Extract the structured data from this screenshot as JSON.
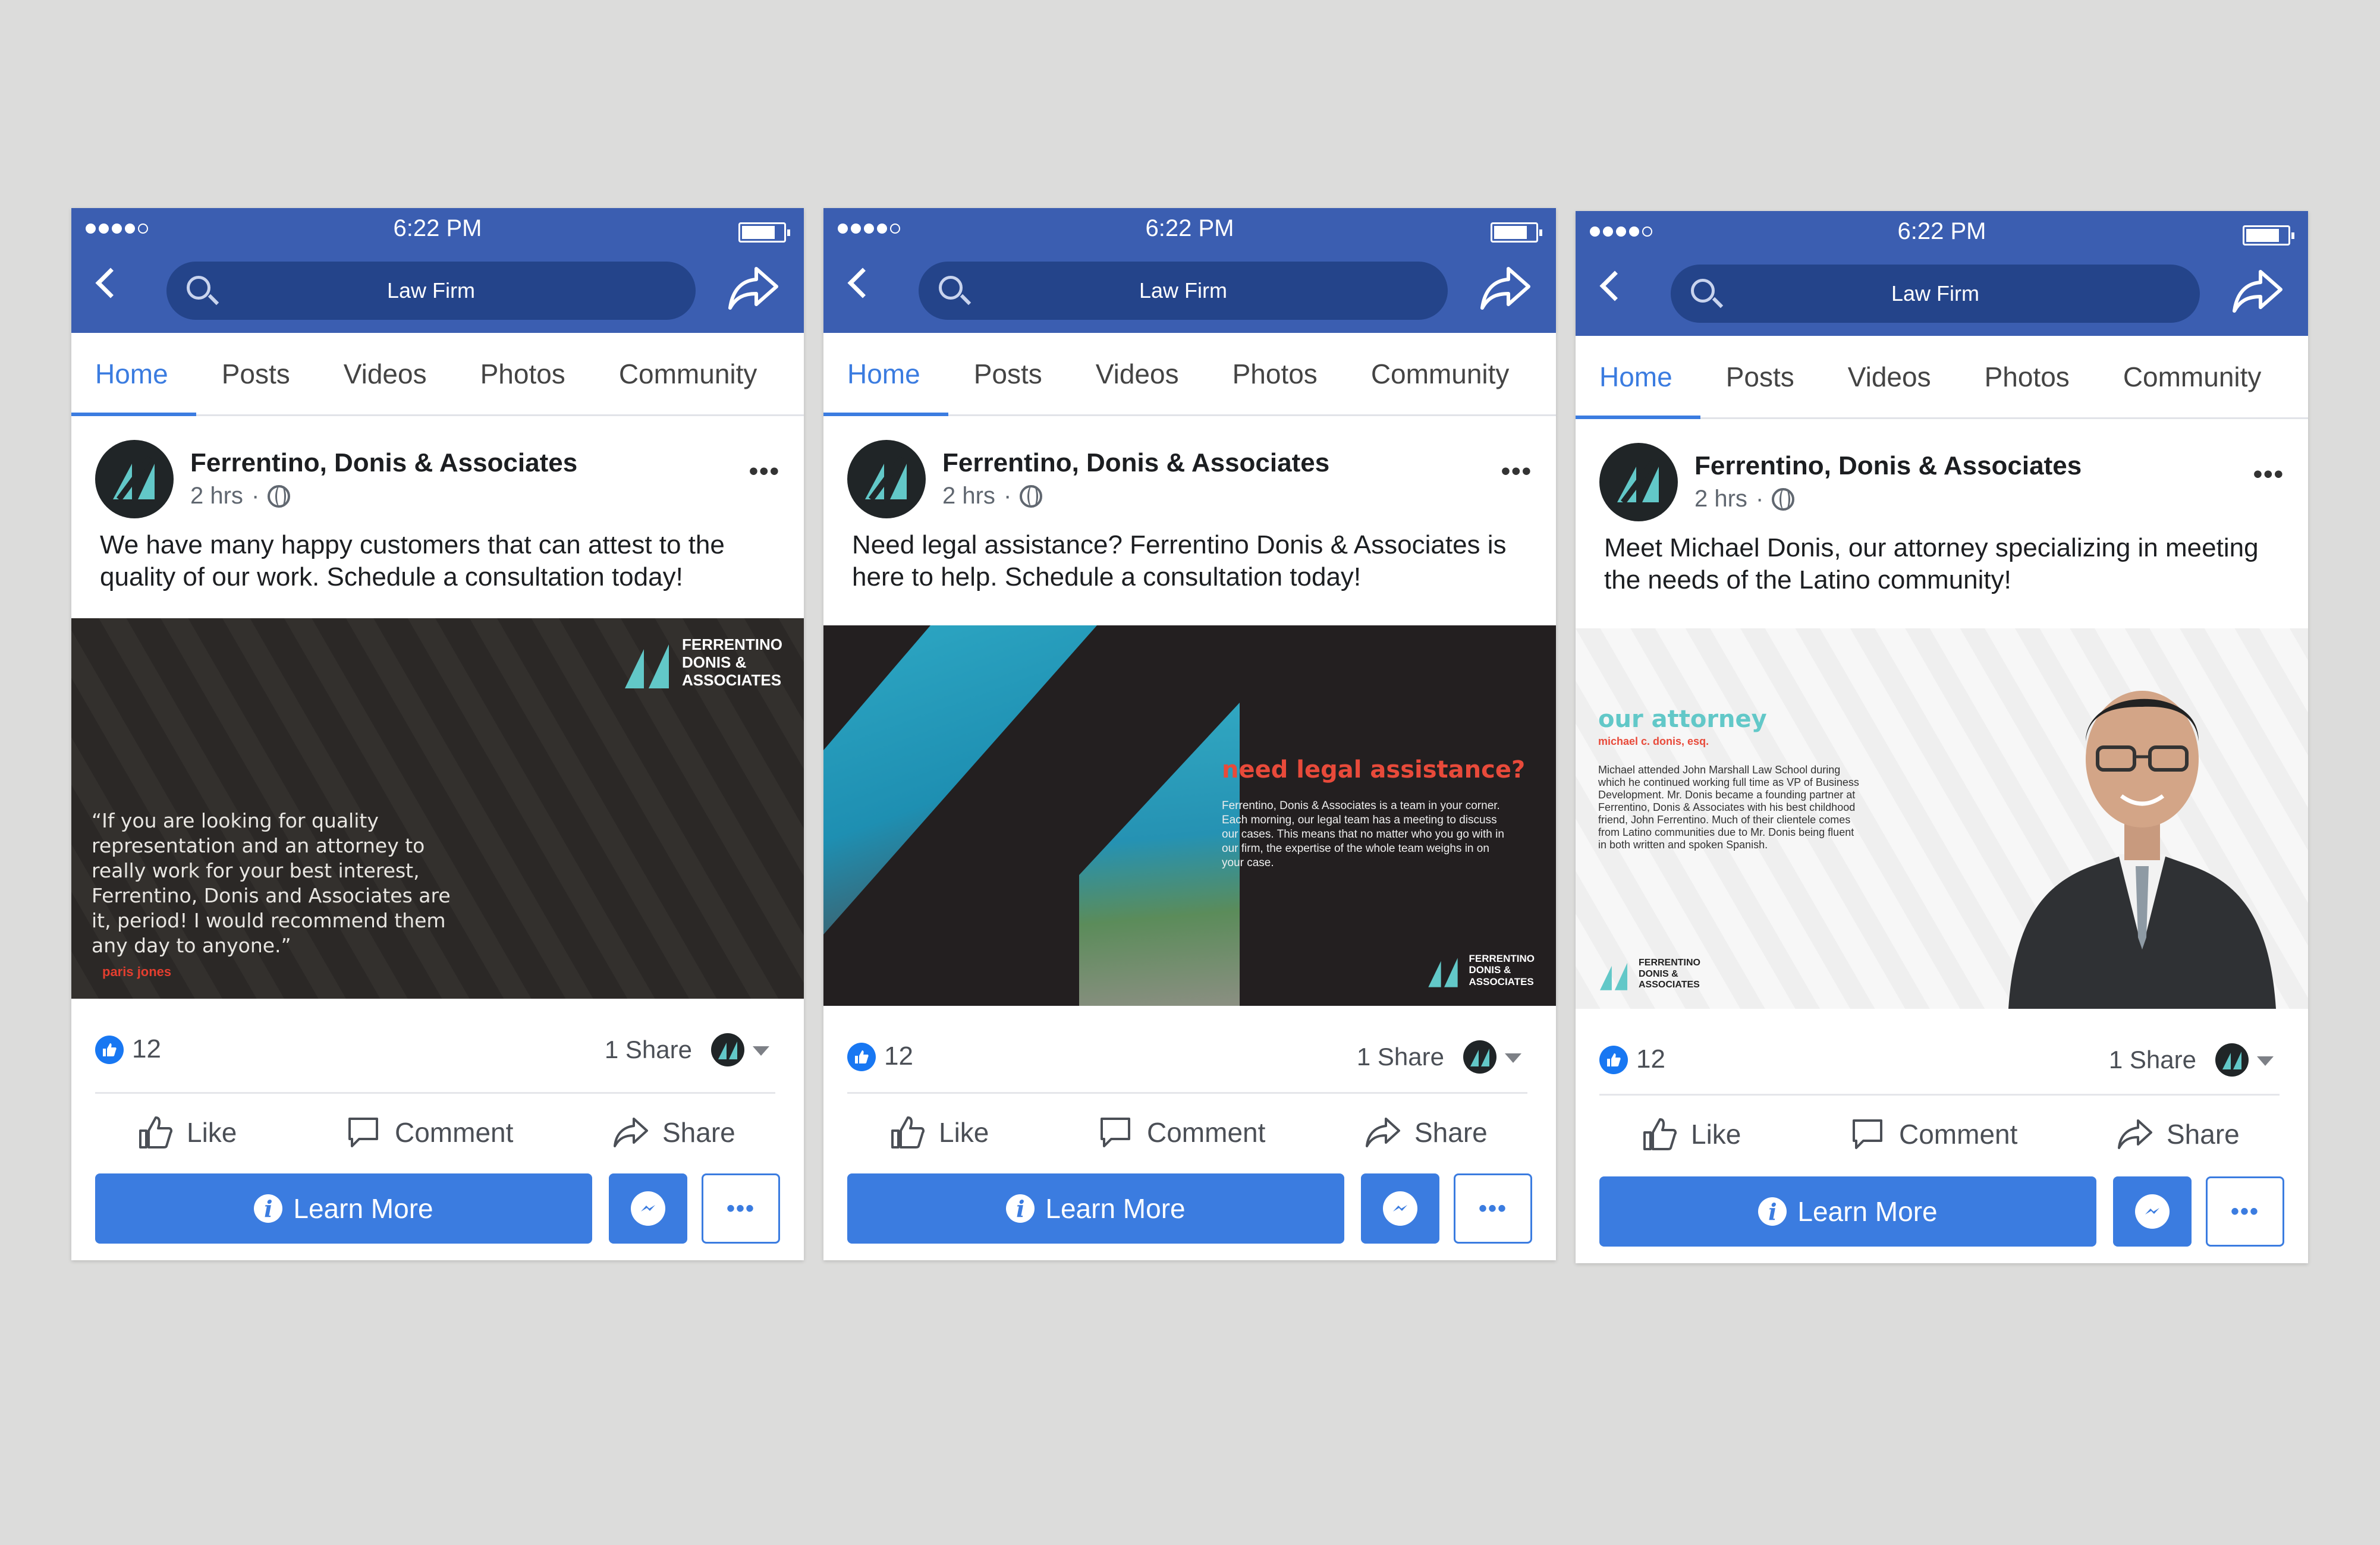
{
  "colors": {
    "background": "#dcdcdb",
    "header": "#3b5eb1",
    "search": "#24448a",
    "accent": "#3b7ce0",
    "brand_teal": "#62c8c8",
    "brand_red": "#e84a3a"
  },
  "status": {
    "time": "6:22 PM"
  },
  "header": {
    "search_text": "Law Firm"
  },
  "tabs": [
    "Home",
    "Posts",
    "Videos",
    "Photos",
    "Community"
  ],
  "brand": {
    "line1": "FERRENTINO",
    "line2": "DONIS &",
    "line3": "ASSOCIATES"
  },
  "posts": [
    {
      "page_name": "Ferrentino, Donis & Associates",
      "time": "2 hrs",
      "caption": "We have many happy customers that can attest to the quality of our work. Schedule a consultation today!",
      "image": {
        "quote": "“If you are looking for quality representation and an attorney to really work for your best interest, Ferrentino, Donis and Associates are it, period! I would recommend them any day to anyone.”",
        "author": "paris jones"
      },
      "likes": "12",
      "shares": "1 Share",
      "actions": {
        "like": "Like",
        "comment": "Comment",
        "share": "Share"
      },
      "cta": "Learn More"
    },
    {
      "page_name": "Ferrentino, Donis & Associates",
      "time": "2 hrs",
      "caption": "Need legal assistance? Ferrentino Donis & Associates is here to help. Schedule a consultation today!",
      "image": {
        "title": "need legal assistance?",
        "body": "Ferrentino, Donis & Associates is a team in your corner. Each morning, our legal team has a meeting to discuss our cases. This means that no matter who you go with in our firm, the expertise of the whole team weighs in on your case."
      },
      "likes": "12",
      "shares": "1 Share",
      "actions": {
        "like": "Like",
        "comment": "Comment",
        "share": "Share"
      },
      "cta": "Learn More"
    },
    {
      "page_name": "Ferrentino, Donis & Associates",
      "time": "2 hrs",
      "caption": "Meet Michael Donis, our attorney specializing in meeting the needs of the Latino community!",
      "image": {
        "title": "our attorney",
        "subtitle": "michael c. donis, esq.",
        "body": "Michael attended John Marshall Law School during which he continued working full time as VP of Business Development. Mr. Donis became a founding partner at Ferrentino, Donis & Associates with his best childhood friend, John Ferrentino. Much of their clientele comes from Latino communities due to Mr. Donis being fluent in both written and spoken Spanish."
      },
      "likes": "12",
      "shares": "1 Share",
      "actions": {
        "like": "Like",
        "comment": "Comment",
        "share": "Share"
      },
      "cta": "Learn More"
    }
  ]
}
